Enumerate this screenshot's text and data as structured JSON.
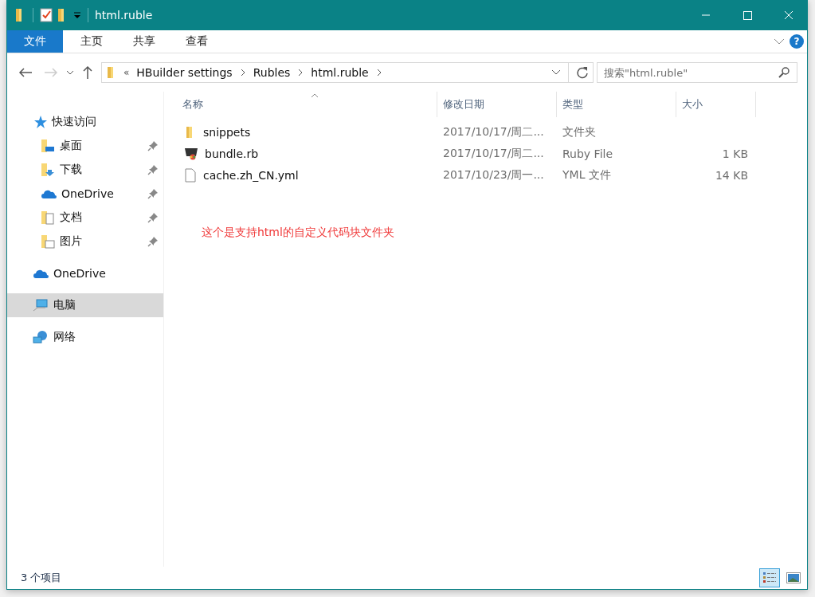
{
  "window": {
    "title": "html.ruble"
  },
  "ribbon": {
    "tabs": [
      {
        "label": "文件",
        "selected": true
      },
      {
        "label": "主页",
        "selected": false
      },
      {
        "label": "共享",
        "selected": false
      },
      {
        "label": "查看",
        "selected": false
      }
    ],
    "help": "?"
  },
  "address": {
    "prefix": "«",
    "crumbs": [
      "HBuilder settings",
      "Rubles",
      "html.ruble"
    ]
  },
  "search": {
    "placeholder": "搜索\"html.ruble\""
  },
  "sidebar": {
    "items": [
      {
        "label": "快速访问",
        "kind": "star",
        "selected": false,
        "children": [
          {
            "label": "桌面",
            "kind": "desktop",
            "pinned": true,
            "selected": false
          },
          {
            "label": "下载",
            "kind": "download",
            "pinned": true,
            "selected": false
          },
          {
            "label": "OneDrive",
            "kind": "cloud",
            "pinned": true,
            "selected": false
          },
          {
            "label": "文档",
            "kind": "docs",
            "pinned": true,
            "selected": false
          },
          {
            "label": "图片",
            "kind": "pictures",
            "pinned": true,
            "selected": false
          }
        ]
      },
      {
        "label": "OneDrive",
        "kind": "cloud",
        "selected": false
      },
      {
        "label": "电脑",
        "kind": "pc",
        "selected": true
      },
      {
        "label": "网络",
        "kind": "network",
        "selected": false
      }
    ]
  },
  "table": {
    "columns": [
      "名称",
      "修改日期",
      "类型",
      "大小"
    ],
    "rows": [
      {
        "name": "snippets",
        "kind": "folder",
        "date": "2017/10/17/周二...",
        "type": "文件夹",
        "size": ""
      },
      {
        "name": "bundle.rb",
        "kind": "ruby",
        "date": "2017/10/17/周二...",
        "type": "Ruby File",
        "size": "1 KB"
      },
      {
        "name": "cache.zh_CN.yml",
        "kind": "file",
        "date": "2017/10/23/周一...",
        "type": "YML 文件",
        "size": "14 KB"
      }
    ]
  },
  "note": "这个是支持html的自定义代码块文件夹",
  "status_bar": {
    "count": "3 个项目",
    "views": [
      {
        "kind": "details",
        "selected": true
      },
      {
        "kind": "large",
        "selected": false
      }
    ]
  }
}
